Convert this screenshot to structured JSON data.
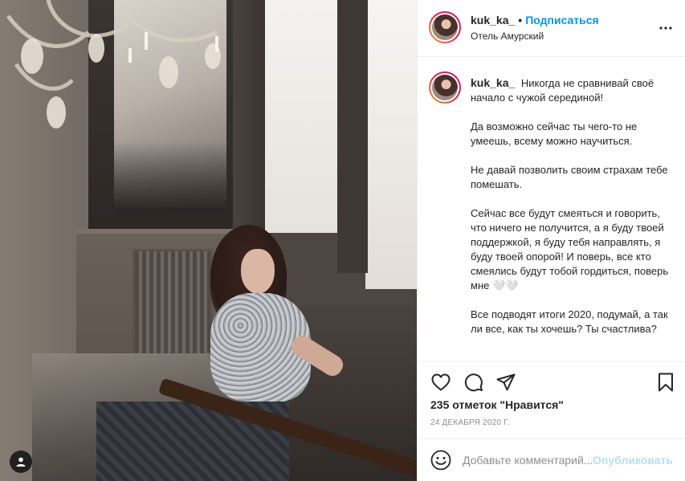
{
  "post": {
    "username": "kuk_ka_",
    "follow_label": "Подписаться",
    "separator": "•",
    "location": "Отель Амурский",
    "more_icon": "ellipsis-icon"
  },
  "caption": {
    "username": "kuk_ka_",
    "paragraphs": [
      "Никогда не сравнивай своё начало с чужой серединой!",
      "Да возможно сейчас ты чего-то не умеешь, всему можно научиться.",
      "Не давай позволить своим страхам тебе помешать.",
      "Сейчас все будут смеяться и говорить, что ничего не получится, а я буду твоей поддержкой, я буду тебя направлять, я буду твоей опорой! И поверь, все кто смеялись будут тобой гордиться, поверь мне 🤍🤍",
      "Все подводят итоги 2020, подумай, а так ли все, как ты хочешь? Ты счастлива?"
    ]
  },
  "actions": {
    "like_icon": "heart-icon",
    "comment_icon": "comment-icon",
    "share_icon": "share-icon",
    "save_icon": "bookmark-icon"
  },
  "likes_text": "235 отметок \"Нравится\"",
  "date": "24 ДЕКАБРЯ 2020 Г.",
  "comment": {
    "placeholder": "Добавьте комментарий...",
    "publish_label": "Опубликовать",
    "emoji_icon": "smiley-icon"
  },
  "photo": {
    "tag_icon": "user-tag-icon"
  },
  "colors": {
    "link_blue": "#0095f6",
    "publish_disabled": "#b2dffc",
    "muted_text": "#8e8e8e",
    "text": "#262626",
    "divider": "#efefef"
  }
}
